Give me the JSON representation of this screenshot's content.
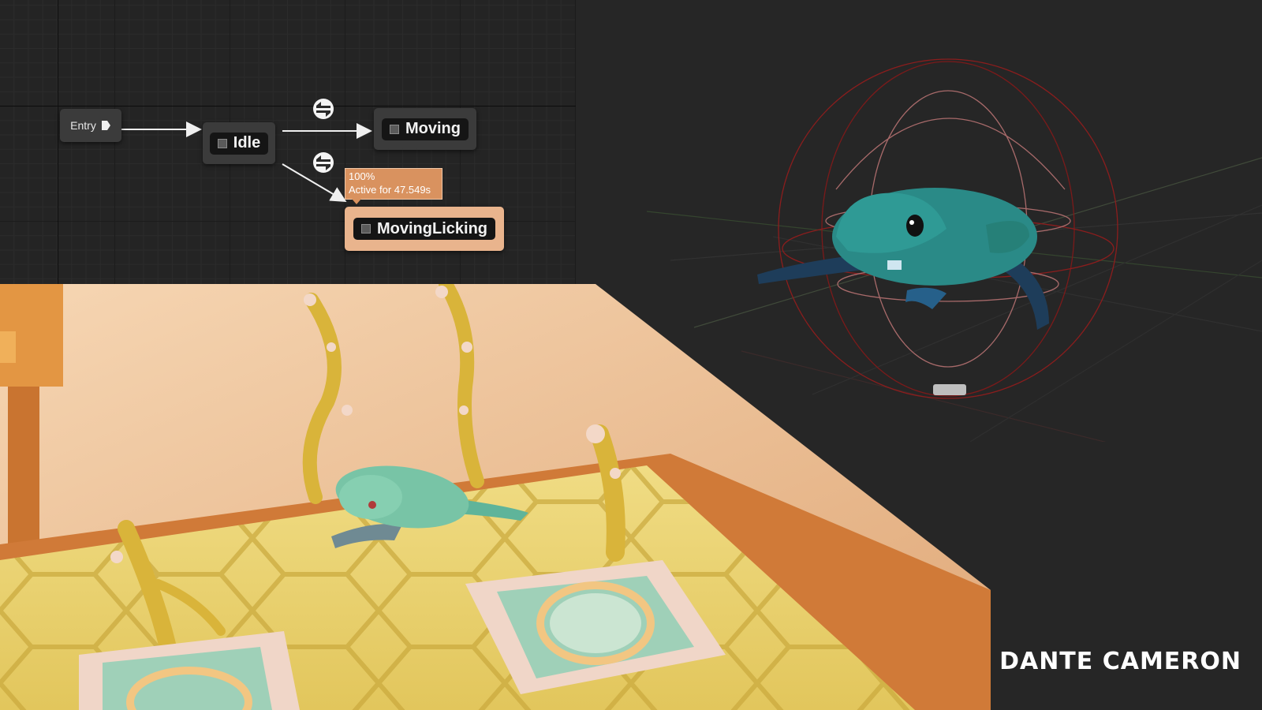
{
  "graph": {
    "nodes": {
      "entry": "Entry",
      "idle": "Idle",
      "moving": "Moving",
      "moving_licking": "MovingLicking"
    },
    "tooltip": {
      "weight": "100%",
      "active": "Active for 47.549s"
    },
    "icons": [
      "entry-arrow-icon",
      "state-square-icon",
      "transition-rule-icon"
    ]
  },
  "credit": "DANTE CAMERON",
  "colors": {
    "graph_bg": "#242424",
    "node_bg": "#3b3b3b",
    "active_node": "#e9b48d",
    "tooltip": "#d9925f",
    "frog_green": "#2a8a87",
    "floor_yellow": "#e9cf6a"
  }
}
